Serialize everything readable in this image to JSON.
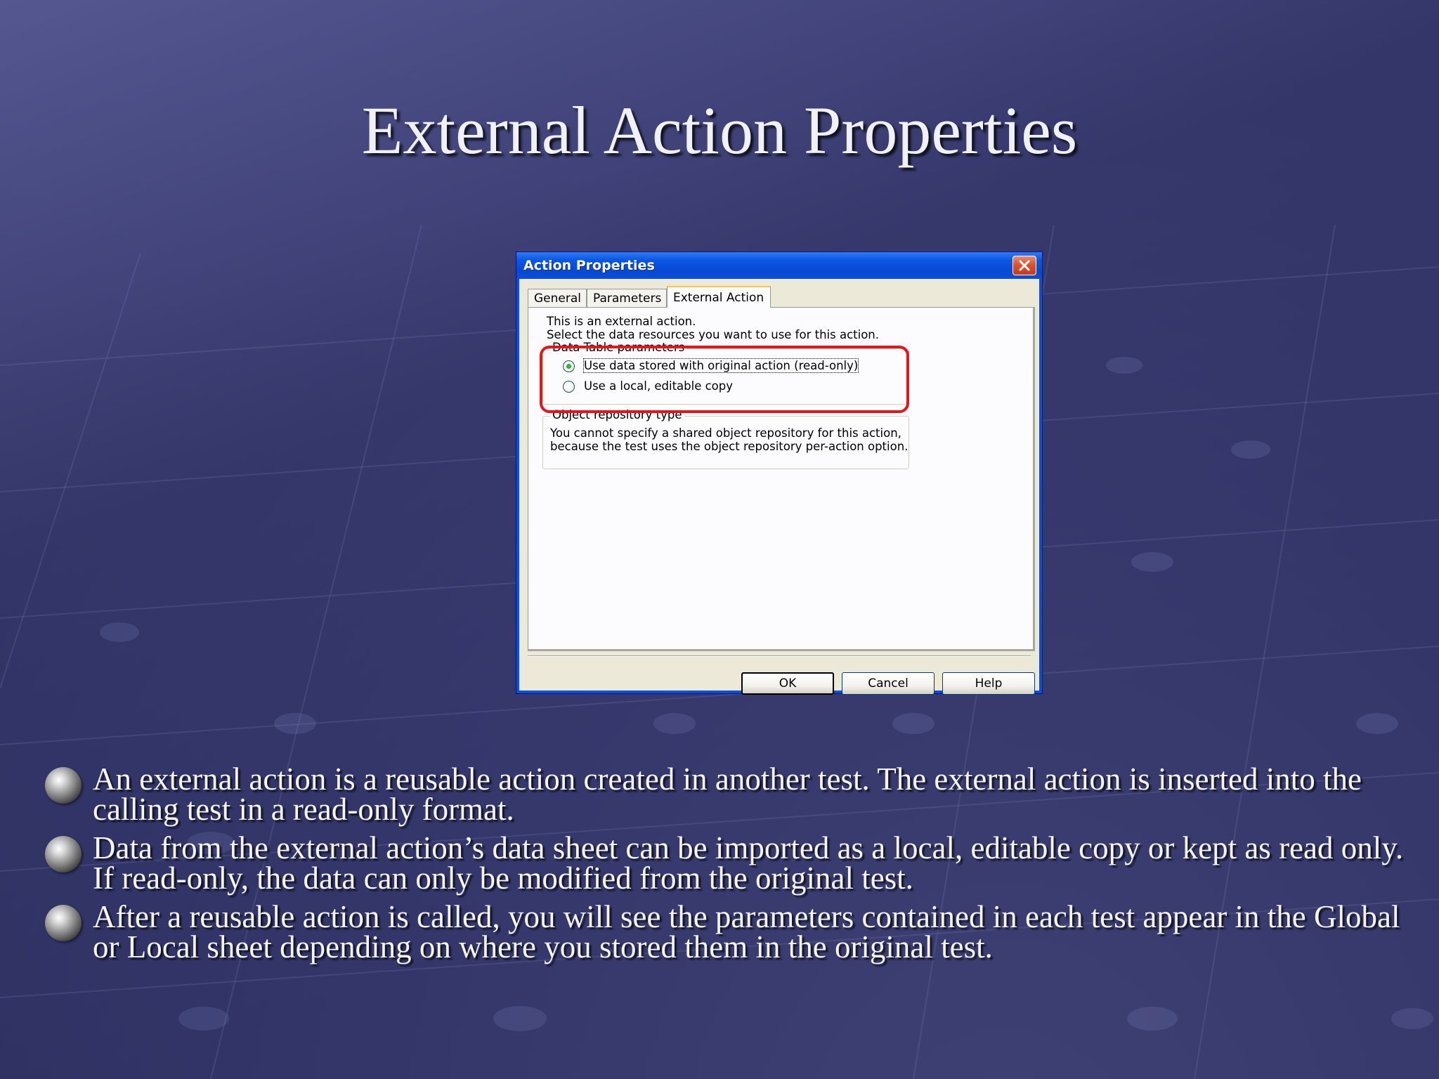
{
  "slide": {
    "title": "External Action Properties",
    "bullets": [
      "An external action is a reusable action created in another test. The external action is inserted into the calling test in a read-only format.",
      "Data from the external action’s data sheet can be imported as a local, editable copy or kept as read only. If read-only, the data can only be modified from the original test.",
      "After a reusable action is called, you will see the parameters contained in each test appear in the Global or Local sheet depending on where you stored them in the original test."
    ]
  },
  "dialog": {
    "title": "Action Properties",
    "tabs": [
      {
        "label": "General",
        "active": false
      },
      {
        "label": "Parameters",
        "active": false
      },
      {
        "label": "External Action",
        "active": true
      }
    ],
    "info_line_1": "This is an external action.",
    "info_line_2": "Select the data resources you want to use for this action.",
    "data_table_group": {
      "legend": "Data Table parameters",
      "options": [
        {
          "label": "Use data stored with original action (read-only)",
          "checked": true
        },
        {
          "label": "Use a local, editable copy",
          "checked": false
        }
      ]
    },
    "object_repository_group": {
      "legend": "Object repository type",
      "line_1": "You cannot specify a shared object repository for this action,",
      "line_2": "because the test uses the object repository per-action option."
    },
    "buttons": {
      "ok": "OK",
      "cancel": "Cancel",
      "help": "Help"
    }
  },
  "colors": {
    "highlight": "#e8141c",
    "titlebar": "#0a57e4",
    "dialog_face": "#ece9d8"
  },
  "icons": {
    "close": "close-icon",
    "bullet": "sphere-bullet-icon"
  }
}
